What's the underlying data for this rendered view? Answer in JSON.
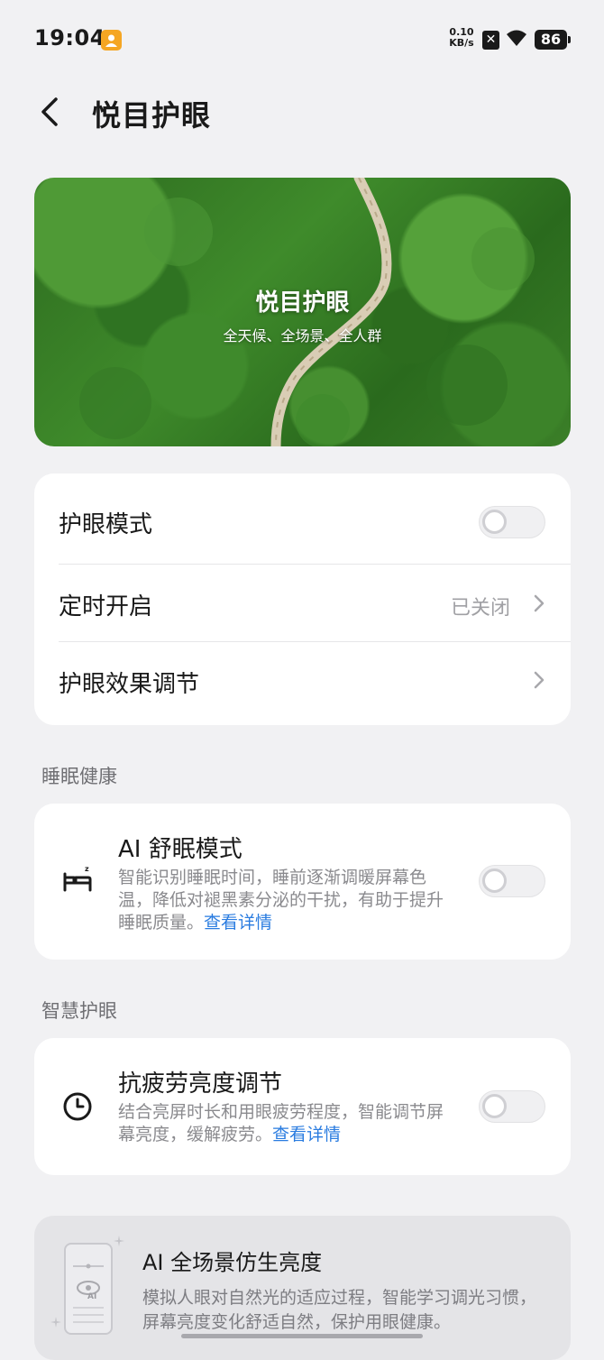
{
  "status_bar": {
    "time": "19:04",
    "net_speed_value": "0.10",
    "net_speed_unit": "KB/s",
    "battery": "86",
    "icons": [
      "notification-app-icon",
      "no-sim-icon",
      "wifi-icon",
      "battery-icon"
    ]
  },
  "header": {
    "title": "悦目护眼",
    "back_icon": "chevron-left-icon"
  },
  "banner": {
    "title": "悦目护眼",
    "subtitle": "全天候、全场景、全人群"
  },
  "settings": {
    "eye_mode": {
      "label": "护眼模式",
      "toggle_on": false
    },
    "schedule": {
      "label": "定时开启",
      "value": "已关闭"
    },
    "effect": {
      "label": "护眼效果调节"
    }
  },
  "sleep_section": {
    "label": "睡眠健康",
    "item": {
      "icon": "bed-icon",
      "title": "AI 舒眠模式",
      "desc": "智能识别睡眠时间，睡前逐渐调暖屏幕色温，降低对褪黑素分泌的干扰，有助于提升睡眠质量。",
      "link": "查看详情",
      "toggle_on": false
    }
  },
  "smart_section": {
    "label": "智慧护眼",
    "item": {
      "icon": "clock-icon",
      "title": "抗疲劳亮度调节",
      "desc": "结合亮屏时长和用眼疲劳程度，智能调节屏幕亮度，缓解疲劳。",
      "link": "查看详情",
      "toggle_on": false
    }
  },
  "promo": {
    "icon": "phone-ai-eye-icon",
    "title": "AI 全场景仿生亮度",
    "desc": "模拟人眼对自然光的适应过程，智能学习调光习惯，屏幕亮度变化舒适自然，保护用眼健康。"
  },
  "colors": {
    "background": "#f1f1f3",
    "card": "#ffffff",
    "link": "#2a7ce0",
    "secondary_text": "#8a8a8e"
  }
}
